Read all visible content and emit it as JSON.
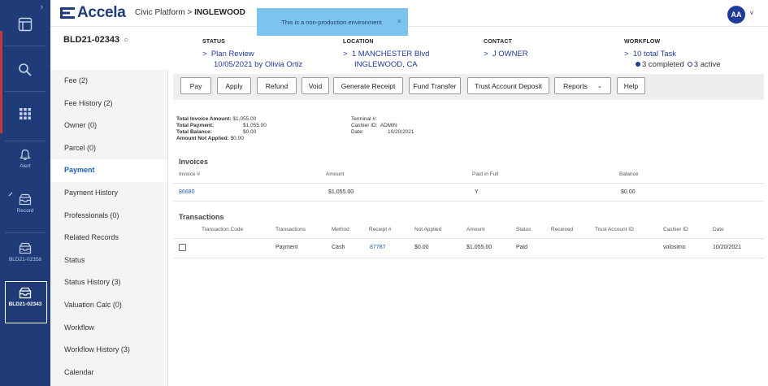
{
  "header": {
    "logo_text": "Accela",
    "breadcrumb_app": "Civic Platform",
    "breadcrumb_sep": ">",
    "breadcrumb_agency": "INGLEWOOD",
    "toast_message": "This is a non-production environment.",
    "toast_close": "×",
    "avatar_initials": "AA",
    "avatar_chevron": "∨"
  },
  "rail": {
    "collapse_chevron": "›",
    "alert_label": "Alert",
    "record_label": "Record",
    "recent1_label": "BLD21-02358",
    "recent2_label": "BLD21-02343"
  },
  "record": {
    "id": "BLD21-02343",
    "refresh_glyph": "○",
    "status": {
      "title": "STATUS",
      "value": "Plan Review",
      "sub": "10/05/2021 by Olivia Ortiz"
    },
    "location": {
      "title": "LOCATION",
      "value": "1 MANCHESTER Blvd",
      "sub": "INGLEWOOD, CA"
    },
    "contact": {
      "title": "CONTACT",
      "value": "J OWNER"
    },
    "workflow": {
      "title": "WORKFLOW",
      "value": "10 total Task",
      "completed": "3 completed",
      "active": "3 active"
    },
    "chevron": ">"
  },
  "sidebar": {
    "items": [
      {
        "label": "Fee (2)"
      },
      {
        "label": "Fee History (2)"
      },
      {
        "label": "Owner (0)"
      },
      {
        "label": "Parcel (0)"
      },
      {
        "label": "Payment"
      },
      {
        "label": "Payment History"
      },
      {
        "label": "Professionals (0)"
      },
      {
        "label": "Related Records"
      },
      {
        "label": "Status"
      },
      {
        "label": "Status History (3)"
      },
      {
        "label": "Valuation Calc (0)"
      },
      {
        "label": "Workflow"
      },
      {
        "label": "Workflow History (3)"
      },
      {
        "label": "Calendar"
      }
    ],
    "active_item": "Payment"
  },
  "toolbar": {
    "pay": "Pay",
    "apply": "Apply",
    "refund": "Refund",
    "void": "Void",
    "generate_receipt": "Generate Receipt",
    "fund_transfer": "Fund Transfer",
    "trust_account_deposit": "Trust Account Deposit",
    "reports": "Reports",
    "reports_chevron": "⌄",
    "help": "Help"
  },
  "summary": {
    "total_invoice_label": "Total Invoice Amount:",
    "total_invoice_value": "$1,055.00",
    "total_payment_label": "Total Payment:",
    "total_payment_value": "$1,055.00",
    "total_balance_label": "Total Balance:",
    "total_balance_value": "$0.00",
    "not_applied_label": "Amount Not Applied:",
    "not_applied_value": "$0.00",
    "terminal_label": "Terminal #:",
    "terminal_value": "",
    "cashier_label": "Cashier ID:",
    "cashier_value": "ADMIN",
    "date_label": "Date:",
    "date_value": "10/20/2021"
  },
  "invoices": {
    "title": "Invoices",
    "headers": [
      "Invoice #",
      "Amount",
      "Paid in Full",
      "Balance"
    ],
    "rows": [
      {
        "invoice": "86680",
        "amount": "$1,055.00",
        "paid": "Y",
        "balance": "$0.00"
      }
    ]
  },
  "transactions": {
    "title": "Transactions",
    "headers": [
      "Transaction Code",
      "Transactions",
      "Method",
      "Receipt #",
      "Not Applied",
      "Amount",
      "Status",
      "Received",
      "Trust Account ID",
      "Cashier ID",
      "Date"
    ],
    "rows": [
      {
        "code": "",
        "type": "Payment",
        "method": "Cash",
        "receipt": "87787",
        "not_applied": "$0.00",
        "amount": "$1,055.00",
        "status": "Paid",
        "received": "",
        "trust": "",
        "cashier": "volosimo",
        "date": "10/20/2021"
      }
    ]
  },
  "colors": {
    "rail": "#1f3b78",
    "accent": "#1f5fb5",
    "toast": "#7cc4ee",
    "rail_marker": "#c8373b"
  }
}
